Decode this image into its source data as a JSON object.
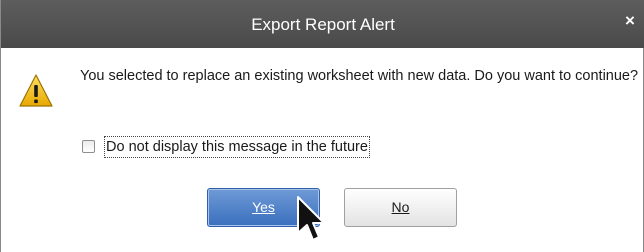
{
  "dialog": {
    "title": "Export Report Alert",
    "close_glyph": "×",
    "icon": "warning-icon",
    "message": "You selected to replace an existing worksheet with new data. Do you want to continue?",
    "checkbox": {
      "label": "Do not display this message in the future",
      "checked": false
    },
    "buttons": {
      "yes_label": "Yes",
      "no_label": "No",
      "default": "yes"
    }
  },
  "colors": {
    "titlebar": "#4f4f4f",
    "yes_button": "#4a7cc7",
    "warning_fill": "#f3c21c"
  }
}
